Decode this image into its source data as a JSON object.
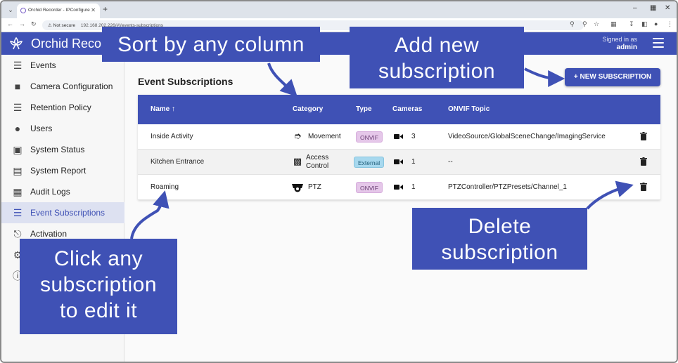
{
  "browser": {
    "tab_title": "Orchid Recorder - IPConfigure",
    "url_warning": "Not secure",
    "url": "192.168.202.226/#!/events-subscriptions"
  },
  "app": {
    "title": "Orchid Reco",
    "signed_in_label": "Signed in as",
    "user": "admin",
    "accent": "#3f51b5"
  },
  "sidebar": {
    "items": [
      {
        "label": "Events",
        "icon": "events-icon"
      },
      {
        "label": "Camera Configuration",
        "icon": "camera-icon"
      },
      {
        "label": "Retention Policy",
        "icon": "database-icon"
      },
      {
        "label": "Users",
        "icon": "user-icon"
      },
      {
        "label": "System Status",
        "icon": "medkit-icon"
      },
      {
        "label": "System Report",
        "icon": "report-icon"
      },
      {
        "label": "Audit Logs",
        "icon": "audit-icon"
      },
      {
        "label": "Event Subscriptions",
        "icon": "subscriptions-icon",
        "active": true
      },
      {
        "label": "Activation",
        "icon": "plug-icon"
      }
    ]
  },
  "main": {
    "heading": "Event Subscriptions",
    "new_button": "NEW SUBSCRIPTION",
    "columns": [
      "Name",
      "Category",
      "Type",
      "Cameras",
      "ONVIF Topic"
    ],
    "sort_indicator": "↑",
    "rows": [
      {
        "name": "Inside Activity",
        "category": "Movement",
        "type": "ONVIF",
        "cameras": "3",
        "topic": "VideoSource/GlobalSceneChange/ImagingService"
      },
      {
        "name": "Kitchen Entrance",
        "category": "Access Control",
        "type": "External",
        "cameras": "1",
        "topic": "--"
      },
      {
        "name": "Roaming",
        "category": "PTZ",
        "type": "ONVIF",
        "cameras": "1",
        "topic": "PTZController/PTZPresets/Channel_1"
      }
    ]
  },
  "annotations": {
    "sort": "Sort by any column",
    "add": [
      "Add new",
      "subscription"
    ],
    "edit": [
      "Click any",
      "subscription",
      "to edit it"
    ],
    "delete": [
      "Delete",
      "subscription"
    ]
  }
}
